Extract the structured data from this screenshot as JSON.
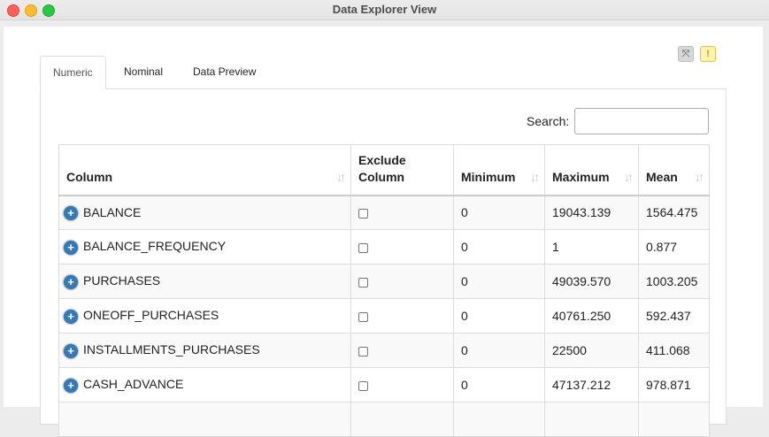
{
  "window": {
    "title": "Data Explorer View"
  },
  "toolbar": {
    "expand_icon": "expand-icon",
    "warning_icon": "warning-icon",
    "warning_symbol": "!"
  },
  "tabs": [
    {
      "label": "Numeric",
      "active": true
    },
    {
      "label": "Nominal",
      "active": false
    },
    {
      "label": "Data Preview",
      "active": false
    }
  ],
  "search": {
    "label": "Search:",
    "value": "",
    "placeholder": ""
  },
  "table": {
    "headers": {
      "column": "Column",
      "exclude_line1": "Exclude",
      "exclude_line2": "Column",
      "minimum": "Minimum",
      "maximum": "Maximum",
      "mean": "Mean"
    },
    "rows": [
      {
        "column": "BALANCE",
        "excluded": false,
        "minimum": "0",
        "maximum": "19043.139",
        "mean": "1564.475"
      },
      {
        "column": "BALANCE_FREQUENCY",
        "excluded": false,
        "minimum": "0",
        "maximum": "1",
        "mean": "0.877"
      },
      {
        "column": "PURCHASES",
        "excluded": false,
        "minimum": "0",
        "maximum": "49039.570",
        "mean": "1003.205"
      },
      {
        "column": "ONEOFF_PURCHASES",
        "excluded": false,
        "minimum": "0",
        "maximum": "40761.250",
        "mean": "592.437"
      },
      {
        "column": "INSTALLMENTS_PURCHASES",
        "excluded": false,
        "minimum": "0",
        "maximum": "22500",
        "mean": "411.068"
      },
      {
        "column": "CASH_ADVANCE",
        "excluded": false,
        "minimum": "0",
        "maximum": "47137.212",
        "mean": "978.871"
      }
    ]
  },
  "colors": {
    "accent": "#337ab7",
    "warning_bg": "#fff3b0"
  }
}
